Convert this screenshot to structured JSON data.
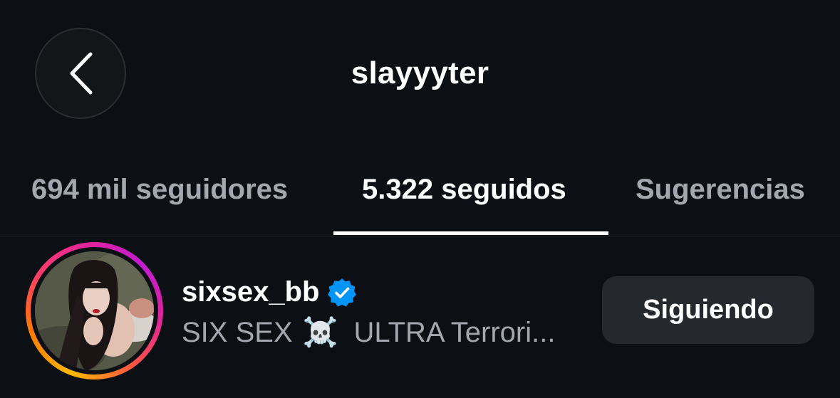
{
  "header": {
    "title": "slayyyter",
    "back_icon": "chevron-left-icon"
  },
  "tabs": [
    {
      "label": "694 mil seguidores",
      "active": false
    },
    {
      "label": "5.322 seguidos",
      "active": true
    },
    {
      "label": "Sugerencias",
      "active": false
    }
  ],
  "list": [
    {
      "username": "sixsex_bb",
      "verified": true,
      "subtitle_prefix": "SIX SEX",
      "subtitle_icon": "☠️",
      "subtitle_suffix": "ULTRA Terrori...",
      "button_label": "Siguiendo",
      "has_story_ring": true
    }
  ],
  "colors": {
    "background": "#0c1014",
    "text_primary": "#ffffff",
    "text_secondary": "#a3a8b0",
    "verified_blue": "#0095f6",
    "button_bg": "#25292e"
  }
}
